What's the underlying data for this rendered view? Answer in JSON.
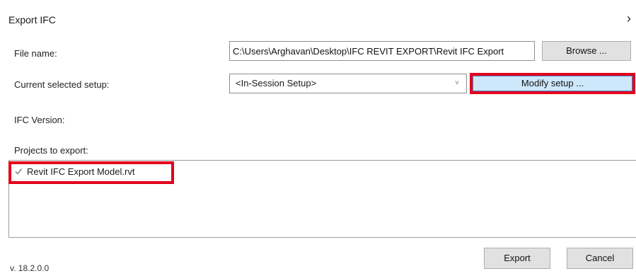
{
  "dialog": {
    "title": "Export IFC",
    "close_symbol": "›"
  },
  "file_name": {
    "label": "File name:",
    "value": "C:\\Users\\Arghavan\\Desktop\\IFC REVIT EXPORT\\Revit IFC Export",
    "browse_label": "Browse ..."
  },
  "setup": {
    "label": "Current selected setup:",
    "selected": "<In-Session Setup>",
    "chevron": "˅",
    "modify_label": "Modify setup ..."
  },
  "ifc_version": {
    "label": "IFC Version:"
  },
  "projects": {
    "label": "Projects to export:",
    "items": [
      {
        "name": "Revit IFC Export Model.rvt",
        "checked": true
      }
    ]
  },
  "footer": {
    "version": "v. 18.2.0.0",
    "export_label": "Export",
    "cancel_label": "Cancel"
  },
  "colors": {
    "highlight": "#e3001b",
    "modify_button_bg": "#cde8fb"
  },
  "icons": {
    "close": "close-icon",
    "dropdown": "chevron-down-icon",
    "checkbox": "checkmark-icon"
  }
}
